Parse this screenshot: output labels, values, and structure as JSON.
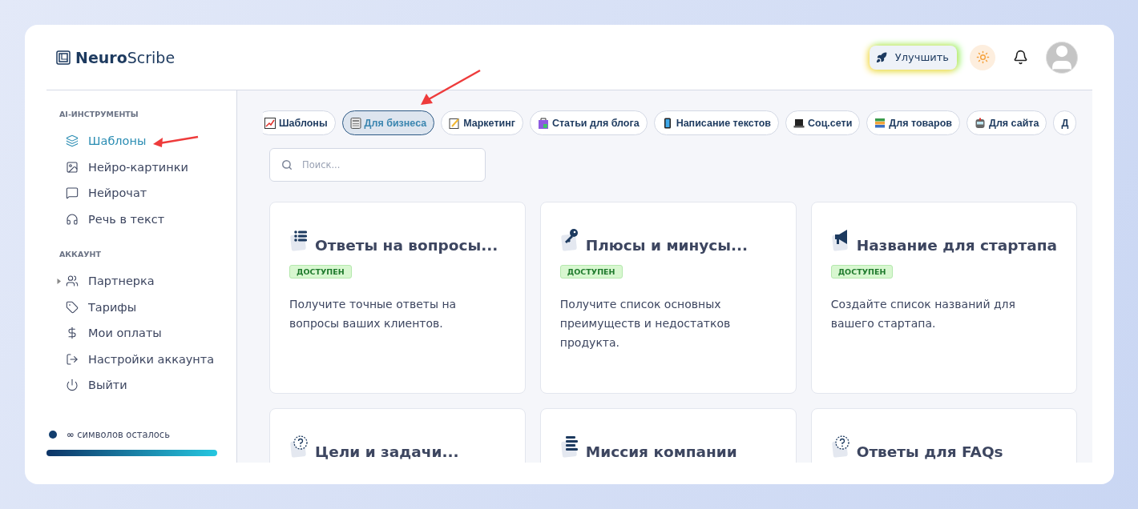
{
  "brand": {
    "bold": "Neuro",
    "light": "Scribe"
  },
  "header": {
    "upgrade": "Улучшить"
  },
  "sidebar": {
    "sections": [
      {
        "heading": "AI-ИНСТРУМЕНТЫ",
        "items": [
          {
            "label": "Шаблоны",
            "selected": true
          },
          {
            "label": "Нейро-картинки",
            "selected": false
          },
          {
            "label": "Нейрочат",
            "selected": false
          },
          {
            "label": "Речь в текст",
            "selected": false
          }
        ]
      },
      {
        "heading": "АККАУНТ",
        "items": [
          {
            "label": "Партнерка",
            "selected": false,
            "expanded": false
          },
          {
            "label": "Тарифы",
            "selected": false
          },
          {
            "label": "Мои оплаты",
            "selected": false
          },
          {
            "label": "Настройки аккаунта",
            "selected": false
          },
          {
            "label": "Выйти",
            "selected": false
          }
        ]
      }
    ],
    "usage": {
      "text": "**∞** символов осталось",
      "level": 1
    }
  },
  "categories": [
    {
      "label": "Шаблоны",
      "selected": false
    },
    {
      "label": "Для бизнеса",
      "selected": true
    },
    {
      "label": "Маркетинг",
      "selected": false
    },
    {
      "label": "Статьи для блога",
      "selected": false
    },
    {
      "label": "Написание текстов",
      "selected": false
    },
    {
      "label": "Соц.сети",
      "selected": false
    },
    {
      "label": "Для товаров",
      "selected": false
    },
    {
      "label": "Для сайта",
      "selected": false
    },
    {
      "label": "Д",
      "selected": false
    }
  ],
  "search": {
    "placeholder": "Поиск..."
  },
  "cards": [
    {
      "title": "Ответы на вопросы...",
      "badge": "ДОСТУПЕН",
      "description": "Получите точные ответы на вопросы ваших клиентов."
    },
    {
      "title": "Плюсы и минусы...",
      "badge": "ДОСТУПЕН",
      "description": "Получите список основных преимуществ и недостатков продукта."
    },
    {
      "title": "Название для стартапа",
      "badge": "ДОСТУПЕН",
      "description": "Создайте список названий для вашего стартапа."
    },
    {
      "title": "Цели и задачи..."
    },
    {
      "title": "Миссия компании"
    },
    {
      "title": "Ответы для FAQs"
    }
  ]
}
